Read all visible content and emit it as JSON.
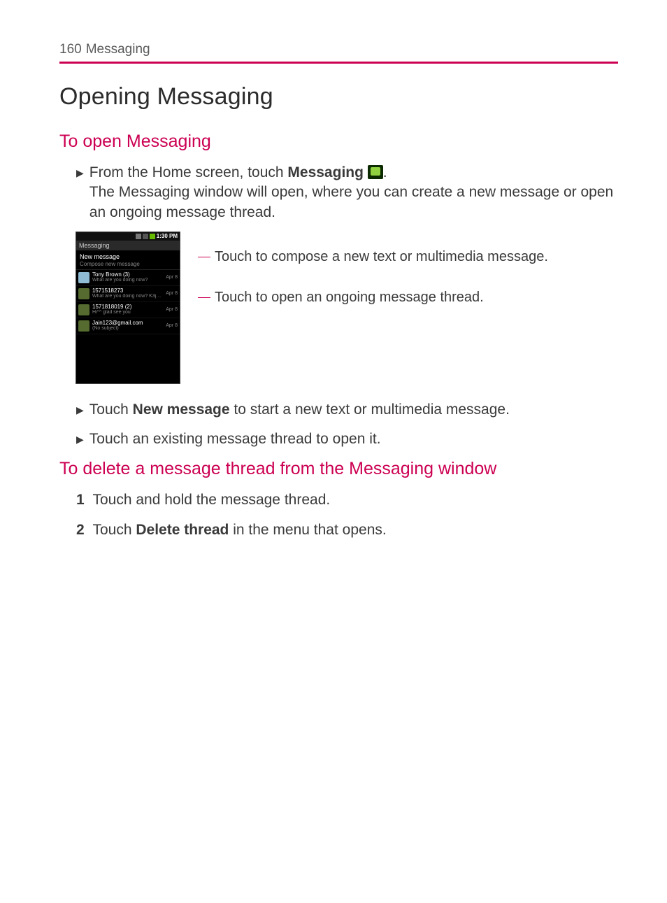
{
  "page_number": "160",
  "section_title": "Messaging",
  "h1": "Opening Messaging",
  "h2_open": "To open Messaging",
  "open_bullet_prefix": "From the Home screen, touch ",
  "open_bullet_strong": "Messaging ",
  "open_bullet_suffix": ".",
  "open_followup": "The Messaging window will open, where you can create a new message or open an ongoing message thread.",
  "callout_compose": "Touch to compose a new text or multimedia message.",
  "callout_thread": "Touch to open an ongoing message thread.",
  "bullet_newmsg_prefix": "Touch ",
  "bullet_newmsg_strong": "New message",
  "bullet_newmsg_suffix": " to start a new text or multimedia message.",
  "bullet_open_thread": "Touch an existing message thread to open it.",
  "h2_delete": "To delete a message thread from the Messaging window",
  "delete_step1": "Touch and hold the message thread.",
  "delete_step2_prefix": "Touch ",
  "delete_step2_strong": "Delete thread",
  "delete_step2_suffix": " in the menu that opens.",
  "phone": {
    "time": "1:30 PM",
    "app_title": "Messaging",
    "new_message_label": "New message",
    "compose_hint": "Compose new message",
    "threads": [
      {
        "name": "Tony Brown (3)",
        "preview": "What are you doing now?",
        "date": "Apr 8",
        "avatar": "p"
      },
      {
        "name": "1571518273",
        "preview": "What are you doing now? K3jo…",
        "date": "Apr 8",
        "avatar": "g"
      },
      {
        "name": "1571818019 (2)",
        "preview": "Hi^^ glad see you",
        "date": "Apr 8",
        "avatar": "g"
      },
      {
        "name": "Jain123@gmail.com",
        "preview": "(No subject)",
        "date": "Apr 8",
        "avatar": "g"
      }
    ]
  }
}
